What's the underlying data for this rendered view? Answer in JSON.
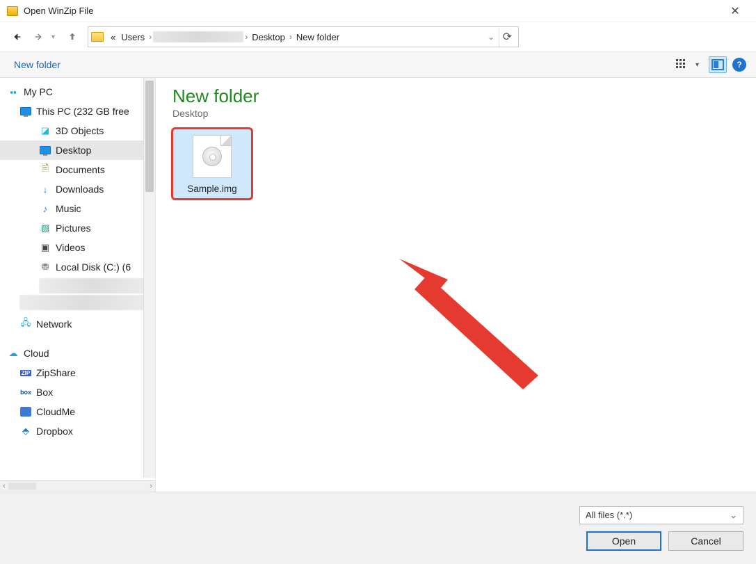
{
  "window": {
    "title": "Open WinZip File"
  },
  "breadcrumb": {
    "prefix": "«",
    "seg_users": "Users",
    "seg_desktop": "Desktop",
    "seg_folder": "New folder"
  },
  "toolbar": {
    "new_folder": "New folder"
  },
  "tree": {
    "my_pc": "My PC",
    "this_pc": "This PC (232 GB free",
    "objects3d": "3D Objects",
    "desktop": "Desktop",
    "documents": "Documents",
    "downloads": "Downloads",
    "music": "Music",
    "pictures": "Pictures",
    "videos": "Videos",
    "localdisk": "Local Disk (C:) (6",
    "network": "Network",
    "cloud": "Cloud",
    "zipshare": "ZipShare",
    "box": "Box",
    "cloudme": "CloudMe",
    "dropbox": "Dropbox"
  },
  "content": {
    "heading": "New folder",
    "subheading": "Desktop",
    "files": [
      {
        "name": "Sample.img"
      }
    ]
  },
  "footer": {
    "filetype": "All files (*.*)",
    "open": "Open",
    "cancel": "Cancel"
  }
}
